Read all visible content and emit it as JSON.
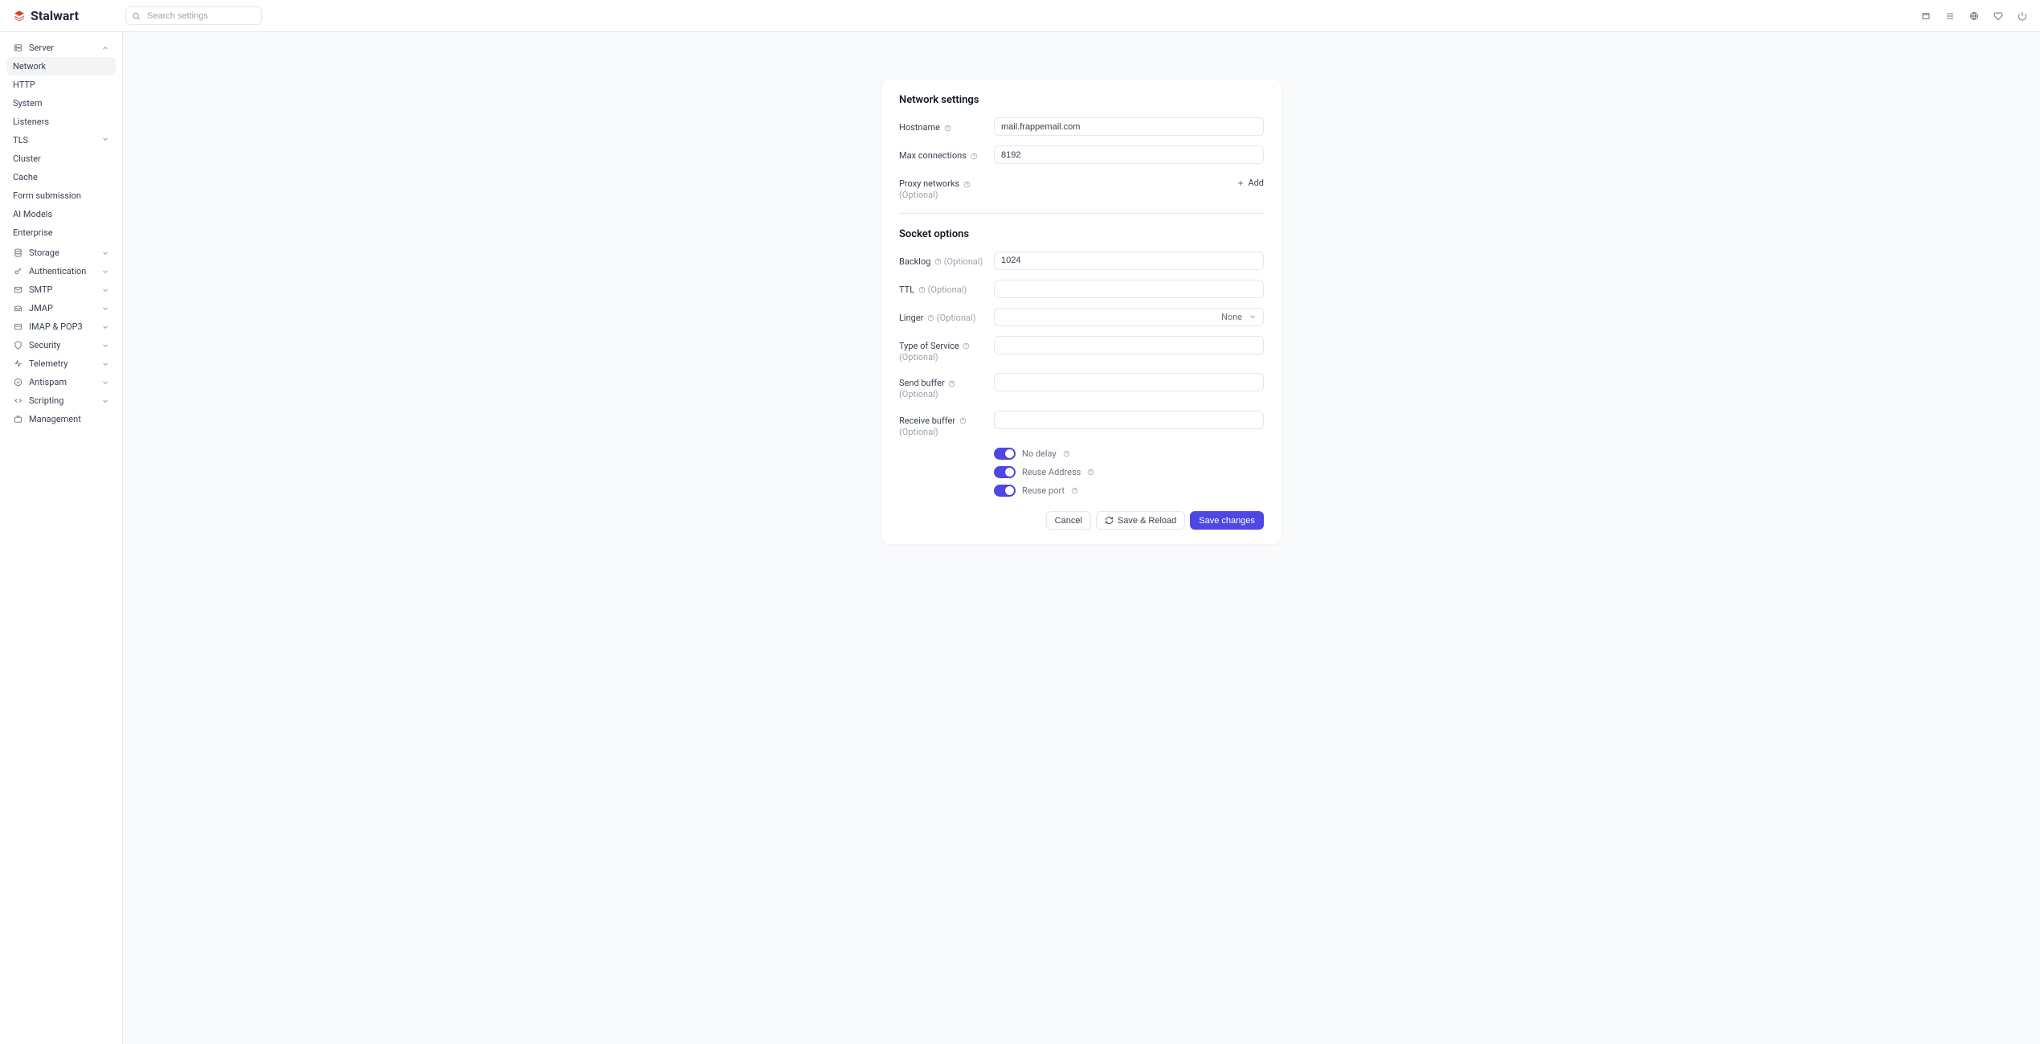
{
  "app": {
    "name": "Stalwart"
  },
  "search": {
    "placeholder": "Search settings"
  },
  "sidebar": {
    "server": {
      "label": "Server",
      "items": [
        {
          "label": "Network",
          "active": true
        },
        {
          "label": "HTTP"
        },
        {
          "label": "System"
        },
        {
          "label": "Listeners"
        },
        {
          "label": "TLS",
          "expandable": true
        },
        {
          "label": "Cluster"
        },
        {
          "label": "Cache"
        },
        {
          "label": "Form submission"
        },
        {
          "label": "AI Models"
        },
        {
          "label": "Enterprise"
        }
      ]
    },
    "sections": [
      {
        "label": "Storage"
      },
      {
        "label": "Authentication"
      },
      {
        "label": "SMTP"
      },
      {
        "label": "JMAP"
      },
      {
        "label": "IMAP & POP3"
      },
      {
        "label": "Security"
      },
      {
        "label": "Telemetry"
      },
      {
        "label": "Antispam"
      },
      {
        "label": "Scripting"
      },
      {
        "label": "Management"
      }
    ]
  },
  "form": {
    "network": {
      "title": "Network settings",
      "hostname": {
        "label": "Hostname",
        "value": "mail.frappemail.com"
      },
      "max_conn": {
        "label": "Max connections",
        "value": "8192"
      },
      "proxy": {
        "label": "Proxy networks",
        "optional": "(Optional)",
        "add": "Add"
      }
    },
    "socket": {
      "title": "Socket options",
      "backlog": {
        "label": "Backlog",
        "optional": "(Optional)",
        "value": "1024"
      },
      "ttl": {
        "label": "TTL",
        "optional": "(Optional)",
        "value": ""
      },
      "linger": {
        "label": "Linger",
        "optional": "(Optional)",
        "selected": "None"
      },
      "tos": {
        "label": "Type of Service",
        "optional": "(Optional)",
        "value": ""
      },
      "sendbuf": {
        "label": "Send buffer",
        "optional": "(Optional)",
        "value": ""
      },
      "recvbuf": {
        "label": "Receive buffer",
        "optional": "(Optional)",
        "value": ""
      },
      "nodelay": {
        "label": "No delay"
      },
      "reuseaddr": {
        "label": "Reuse Address"
      },
      "reuseport": {
        "label": "Reuse port"
      }
    },
    "actions": {
      "cancel": "Cancel",
      "save_reload": "Save & Reload",
      "save": "Save changes"
    }
  }
}
